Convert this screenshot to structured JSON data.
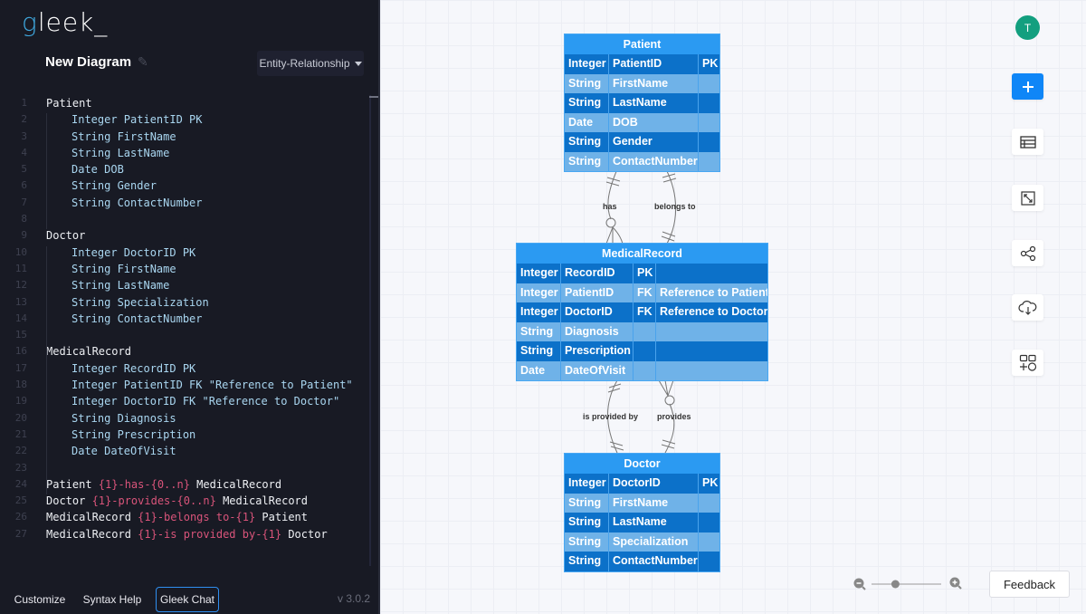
{
  "app": {
    "logo_g": "g",
    "logo_rest": "leek_",
    "version": "v 3.0.2"
  },
  "header": {
    "title": "New Diagram",
    "diagram_type": "Entity-Relationship"
  },
  "editor": {
    "lines": [
      {
        "n": "1",
        "text": "Patient",
        "indent": false
      },
      {
        "n": "2",
        "text": "Integer PatientID PK",
        "indent": true
      },
      {
        "n": "3",
        "text": "String FirstName",
        "indent": true
      },
      {
        "n": "4",
        "text": "String LastName",
        "indent": true
      },
      {
        "n": "5",
        "text": "Date DOB",
        "indent": true
      },
      {
        "n": "6",
        "text": "String Gender",
        "indent": true
      },
      {
        "n": "7",
        "text": "String ContactNumber",
        "indent": true
      },
      {
        "n": "8",
        "text": "",
        "indent": false
      },
      {
        "n": "9",
        "text": "Doctor",
        "indent": false
      },
      {
        "n": "10",
        "text": "Integer DoctorID PK",
        "indent": true
      },
      {
        "n": "11",
        "text": "String FirstName",
        "indent": true
      },
      {
        "n": "12",
        "text": "String LastName",
        "indent": true
      },
      {
        "n": "13",
        "text": "String Specialization",
        "indent": true
      },
      {
        "n": "14",
        "text": "String ContactNumber",
        "indent": true
      },
      {
        "n": "15",
        "text": "",
        "indent": false
      },
      {
        "n": "16",
        "text": "MedicalRecord",
        "indent": false
      },
      {
        "n": "17",
        "text": "Integer RecordID PK",
        "indent": true
      },
      {
        "n": "18",
        "text": "Integer PatientID FK \"Reference to Patient\"",
        "indent": true
      },
      {
        "n": "19",
        "text": "Integer DoctorID FK \"Reference to Doctor\"",
        "indent": true
      },
      {
        "n": "20",
        "text": "String Diagnosis",
        "indent": true
      },
      {
        "n": "21",
        "text": "String Prescription",
        "indent": true
      },
      {
        "n": "22",
        "text": "Date DateOfVisit",
        "indent": true
      },
      {
        "n": "23",
        "text": "",
        "indent": false
      },
      {
        "n": "24",
        "pre": "Patient ",
        "rel": "{1}-has-{0..n}",
        "post": " MedicalRecord"
      },
      {
        "n": "25",
        "pre": "Doctor ",
        "rel": "{1}-provides-{0..n}",
        "post": " MedicalRecord"
      },
      {
        "n": "26",
        "pre": "MedicalRecord ",
        "rel": "{1}-belongs to-{1}",
        "post": " Patient"
      },
      {
        "n": "27",
        "pre": "MedicalRecord ",
        "rel": "{1}-is provided by-{1}",
        "post": " Doctor"
      }
    ]
  },
  "footer": {
    "customize": "Customize",
    "syntax_help": "Syntax Help",
    "gleek_chat": "Gleek Chat"
  },
  "diagram": {
    "entities": [
      {
        "name": "Patient",
        "rows": [
          [
            "Integer",
            "PatientID",
            "PK"
          ],
          [
            "String",
            "FirstName",
            ""
          ],
          [
            "String",
            "LastName",
            ""
          ],
          [
            "Date",
            "DOB",
            ""
          ],
          [
            "String",
            "Gender",
            ""
          ],
          [
            "String",
            "ContactNumber",
            ""
          ]
        ]
      },
      {
        "name": "MedicalRecord",
        "rows": [
          [
            "Integer",
            "RecordID",
            "PK",
            ""
          ],
          [
            "Integer",
            "PatientID",
            "FK",
            "Reference to Patient"
          ],
          [
            "Integer",
            "DoctorID",
            "FK",
            "Reference to Doctor"
          ],
          [
            "String",
            "Diagnosis",
            "",
            ""
          ],
          [
            "String",
            "Prescription",
            "",
            ""
          ],
          [
            "Date",
            "DateOfVisit",
            "",
            ""
          ]
        ]
      },
      {
        "name": "Doctor",
        "rows": [
          [
            "Integer",
            "DoctorID",
            "PK"
          ],
          [
            "String",
            "FirstName",
            ""
          ],
          [
            "String",
            "LastName",
            ""
          ],
          [
            "String",
            "Specialization",
            ""
          ],
          [
            "String",
            "ContactNumber",
            ""
          ]
        ]
      }
    ],
    "relationships": [
      {
        "label": "has",
        "from": "Patient",
        "to": "MedicalRecord",
        "from_card": "1",
        "to_card": "0..n"
      },
      {
        "label": "belongs to",
        "from": "MedicalRecord",
        "to": "Patient",
        "from_card": "1",
        "to_card": "1"
      },
      {
        "label": "is provided by",
        "from": "MedicalRecord",
        "to": "Doctor",
        "from_card": "1",
        "to_card": "1"
      },
      {
        "label": "provides",
        "from": "Doctor",
        "to": "MedicalRecord",
        "from_card": "1",
        "to_card": "0..n"
      }
    ]
  },
  "toolbar": {
    "avatar_initial": "T",
    "feedback": "Feedback",
    "zoom_level": 0.2
  },
  "colors": {
    "accent": "#0f86f7",
    "entity_header": "#2b9af2",
    "row_dark": "#0c71c9",
    "row_light": "#6fb2e8",
    "avatar": "#139f7f",
    "relationship_text": "#d9547a"
  }
}
